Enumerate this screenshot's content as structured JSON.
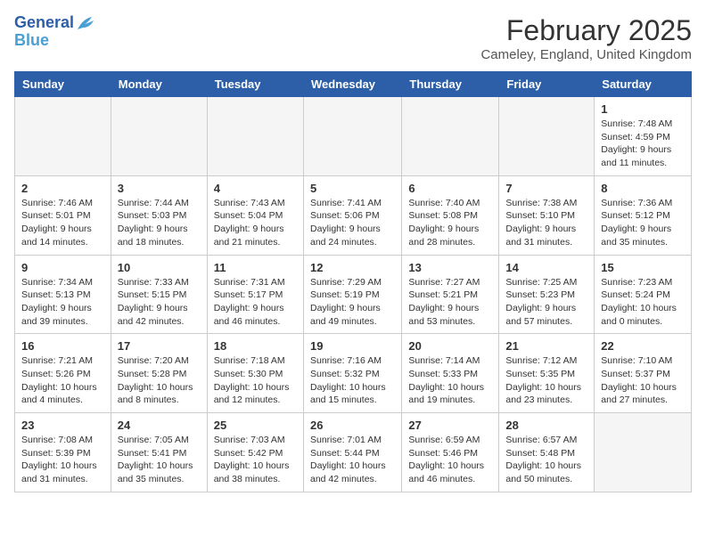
{
  "logo": {
    "line1": "General",
    "line2": "Blue"
  },
  "title": "February 2025",
  "subtitle": "Cameley, England, United Kingdom",
  "headers": [
    "Sunday",
    "Monday",
    "Tuesday",
    "Wednesday",
    "Thursday",
    "Friday",
    "Saturday"
  ],
  "weeks": [
    [
      {
        "day": "",
        "info": ""
      },
      {
        "day": "",
        "info": ""
      },
      {
        "day": "",
        "info": ""
      },
      {
        "day": "",
        "info": ""
      },
      {
        "day": "",
        "info": ""
      },
      {
        "day": "",
        "info": ""
      },
      {
        "day": "1",
        "info": "Sunrise: 7:48 AM\nSunset: 4:59 PM\nDaylight: 9 hours and 11 minutes."
      }
    ],
    [
      {
        "day": "2",
        "info": "Sunrise: 7:46 AM\nSunset: 5:01 PM\nDaylight: 9 hours and 14 minutes."
      },
      {
        "day": "3",
        "info": "Sunrise: 7:44 AM\nSunset: 5:03 PM\nDaylight: 9 hours and 18 minutes."
      },
      {
        "day": "4",
        "info": "Sunrise: 7:43 AM\nSunset: 5:04 PM\nDaylight: 9 hours and 21 minutes."
      },
      {
        "day": "5",
        "info": "Sunrise: 7:41 AM\nSunset: 5:06 PM\nDaylight: 9 hours and 24 minutes."
      },
      {
        "day": "6",
        "info": "Sunrise: 7:40 AM\nSunset: 5:08 PM\nDaylight: 9 hours and 28 minutes."
      },
      {
        "day": "7",
        "info": "Sunrise: 7:38 AM\nSunset: 5:10 PM\nDaylight: 9 hours and 31 minutes."
      },
      {
        "day": "8",
        "info": "Sunrise: 7:36 AM\nSunset: 5:12 PM\nDaylight: 9 hours and 35 minutes."
      }
    ],
    [
      {
        "day": "9",
        "info": "Sunrise: 7:34 AM\nSunset: 5:13 PM\nDaylight: 9 hours and 39 minutes."
      },
      {
        "day": "10",
        "info": "Sunrise: 7:33 AM\nSunset: 5:15 PM\nDaylight: 9 hours and 42 minutes."
      },
      {
        "day": "11",
        "info": "Sunrise: 7:31 AM\nSunset: 5:17 PM\nDaylight: 9 hours and 46 minutes."
      },
      {
        "day": "12",
        "info": "Sunrise: 7:29 AM\nSunset: 5:19 PM\nDaylight: 9 hours and 49 minutes."
      },
      {
        "day": "13",
        "info": "Sunrise: 7:27 AM\nSunset: 5:21 PM\nDaylight: 9 hours and 53 minutes."
      },
      {
        "day": "14",
        "info": "Sunrise: 7:25 AM\nSunset: 5:23 PM\nDaylight: 9 hours and 57 minutes."
      },
      {
        "day": "15",
        "info": "Sunrise: 7:23 AM\nSunset: 5:24 PM\nDaylight: 10 hours and 0 minutes."
      }
    ],
    [
      {
        "day": "16",
        "info": "Sunrise: 7:21 AM\nSunset: 5:26 PM\nDaylight: 10 hours and 4 minutes."
      },
      {
        "day": "17",
        "info": "Sunrise: 7:20 AM\nSunset: 5:28 PM\nDaylight: 10 hours and 8 minutes."
      },
      {
        "day": "18",
        "info": "Sunrise: 7:18 AM\nSunset: 5:30 PM\nDaylight: 10 hours and 12 minutes."
      },
      {
        "day": "19",
        "info": "Sunrise: 7:16 AM\nSunset: 5:32 PM\nDaylight: 10 hours and 15 minutes."
      },
      {
        "day": "20",
        "info": "Sunrise: 7:14 AM\nSunset: 5:33 PM\nDaylight: 10 hours and 19 minutes."
      },
      {
        "day": "21",
        "info": "Sunrise: 7:12 AM\nSunset: 5:35 PM\nDaylight: 10 hours and 23 minutes."
      },
      {
        "day": "22",
        "info": "Sunrise: 7:10 AM\nSunset: 5:37 PM\nDaylight: 10 hours and 27 minutes."
      }
    ],
    [
      {
        "day": "23",
        "info": "Sunrise: 7:08 AM\nSunset: 5:39 PM\nDaylight: 10 hours and 31 minutes."
      },
      {
        "day": "24",
        "info": "Sunrise: 7:05 AM\nSunset: 5:41 PM\nDaylight: 10 hours and 35 minutes."
      },
      {
        "day": "25",
        "info": "Sunrise: 7:03 AM\nSunset: 5:42 PM\nDaylight: 10 hours and 38 minutes."
      },
      {
        "day": "26",
        "info": "Sunrise: 7:01 AM\nSunset: 5:44 PM\nDaylight: 10 hours and 42 minutes."
      },
      {
        "day": "27",
        "info": "Sunrise: 6:59 AM\nSunset: 5:46 PM\nDaylight: 10 hours and 46 minutes."
      },
      {
        "day": "28",
        "info": "Sunrise: 6:57 AM\nSunset: 5:48 PM\nDaylight: 10 hours and 50 minutes."
      },
      {
        "day": "",
        "info": ""
      }
    ]
  ]
}
